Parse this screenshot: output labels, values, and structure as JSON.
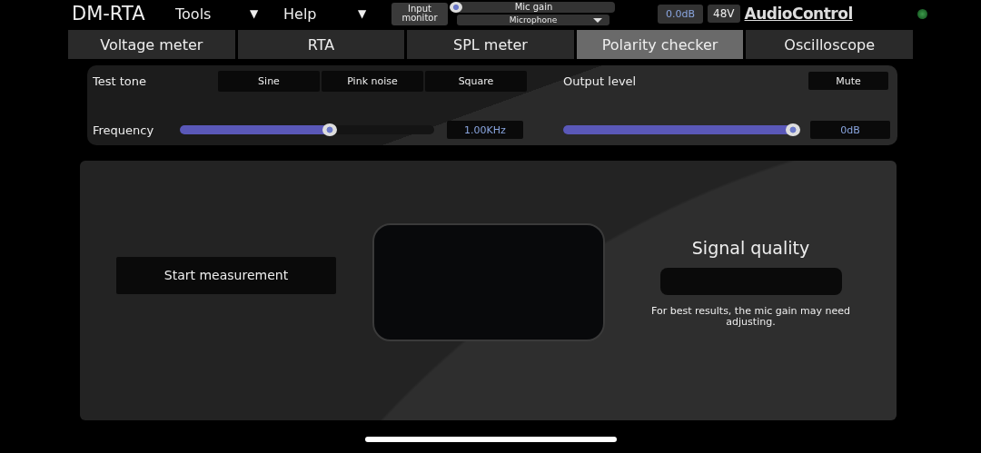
{
  "header": {
    "title": "DM-RTA",
    "menus": [
      {
        "label": "Tools",
        "caret": "▼"
      },
      {
        "label": "Help",
        "caret": "▼"
      }
    ],
    "input_monitor": "Input monitor",
    "mic_gain": {
      "label": "Mic gain",
      "level": 0.02
    },
    "input_select": "Microphone",
    "gain_readout": "0.0dB",
    "phantom": "48V",
    "logo": "AudioControl",
    "led_on": true
  },
  "tabs": [
    {
      "label": "Voltage meter",
      "selected": false
    },
    {
      "label": "RTA",
      "selected": false
    },
    {
      "label": "SPL meter",
      "selected": false
    },
    {
      "label": "Polarity checker",
      "selected": true
    },
    {
      "label": "Oscilloscope",
      "selected": false
    }
  ],
  "controls": {
    "test_tone_label": "Test tone",
    "tones": [
      {
        "label": "Sine",
        "selected": false
      },
      {
        "label": "Pink noise",
        "selected": false
      },
      {
        "label": "Square",
        "selected": false
      }
    ],
    "output_level_label": "Output level",
    "mute": {
      "label": "Mute",
      "on": false
    },
    "frequency_label": "Frequency",
    "frequency": {
      "level": 0.59,
      "reading": "1.00KHz"
    },
    "output": {
      "level": 0.98,
      "reading": "0dB"
    }
  },
  "measurement": {
    "start_button": "Start measurement",
    "signal_quality_title": "Signal quality",
    "hint": "For best results, the mic gain may need adjusting."
  }
}
